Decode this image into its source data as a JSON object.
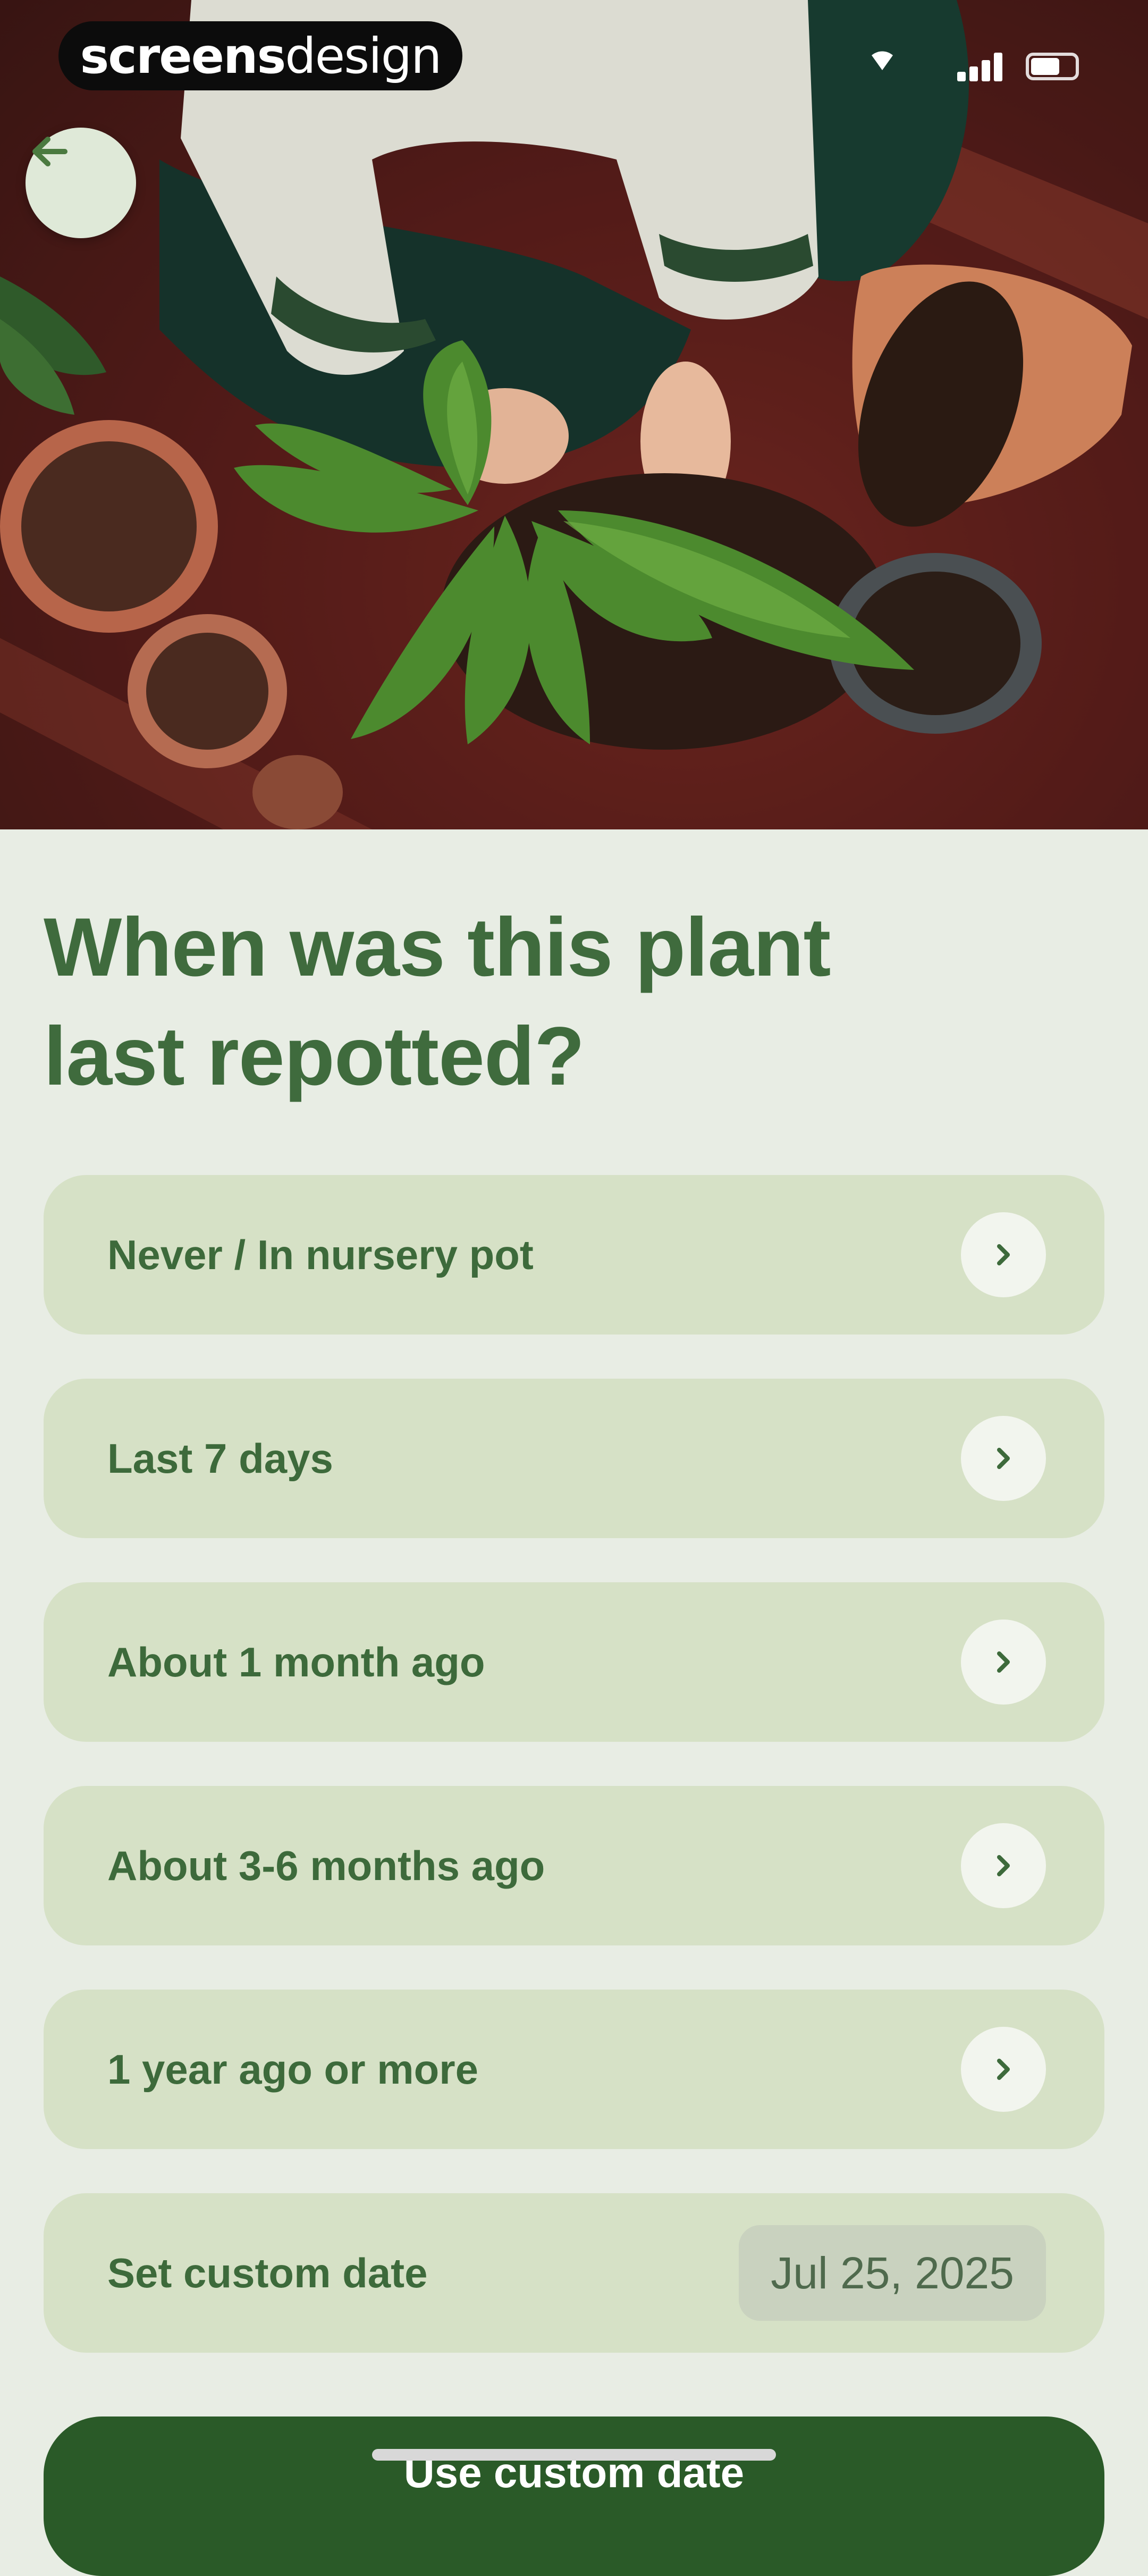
{
  "status_bar": {
    "brand_bold": "screens",
    "brand_light": "design",
    "signal_icon": "signal-icon",
    "wifi_icon": "wifi-icon",
    "battery_icon": "battery-icon"
  },
  "nav": {
    "back_icon": "arrow-left-icon"
  },
  "hero": {
    "image": "person repotting green plant among terracotta pots on red rug"
  },
  "question": {
    "line1": "When was this plant",
    "line2": "last repotted?"
  },
  "options": [
    {
      "label": "Never / In nursery pot",
      "icon": "chevron-right-icon"
    },
    {
      "label": "Last 7 days",
      "icon": "chevron-right-icon"
    },
    {
      "label": "About 1 month ago",
      "icon": "chevron-right-icon"
    },
    {
      "label": "About 3-6 months ago",
      "icon": "chevron-right-icon"
    },
    {
      "label": "1 year ago or more",
      "icon": "chevron-right-icon"
    }
  ],
  "custom_date": {
    "label": "Set custom date",
    "value": "Jul 25, 2025"
  },
  "primary_button": {
    "label": "Use custom date"
  },
  "colors": {
    "background": "#e8ede4",
    "card": "#d6e1c6",
    "accent_text": "#3f6b3d",
    "primary_button": "#2a5a28"
  }
}
